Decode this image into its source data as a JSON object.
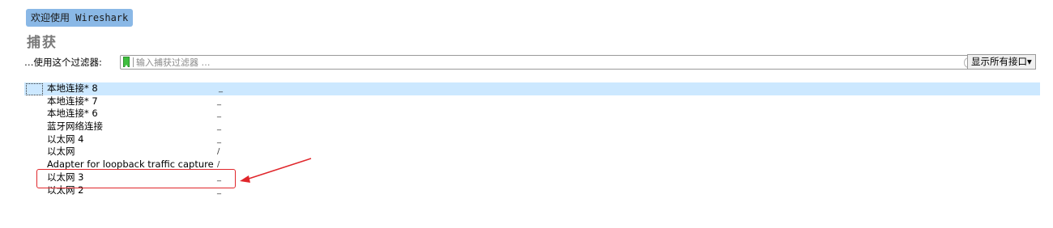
{
  "welcome": "欢迎使用 Wireshark",
  "section_title": "捕获",
  "filter": {
    "label": "…使用这个过滤器:",
    "placeholder": "输入捕获过滤器 …",
    "show_all_label": "显示所有接口▾"
  },
  "interfaces": [
    {
      "name": "本地连接* 8",
      "activity": "_"
    },
    {
      "name": "本地连接* 7",
      "activity": "_"
    },
    {
      "name": "本地连接* 6",
      "activity": "_"
    },
    {
      "name": "蓝牙网络连接",
      "activity": "_"
    },
    {
      "name": "以太网 4",
      "activity": "_"
    },
    {
      "name": "以太网",
      "activity": "/"
    },
    {
      "name": "Adapter for loopback traffic capture",
      "activity": "/"
    },
    {
      "name": "以太网 3",
      "activity": "_"
    },
    {
      "name": "以太网 2",
      "activity": "_"
    }
  ],
  "colors": {
    "welcome_bg": "#8ab8e6",
    "selected_row": "#cce8ff",
    "annotation": "#e0262b"
  }
}
